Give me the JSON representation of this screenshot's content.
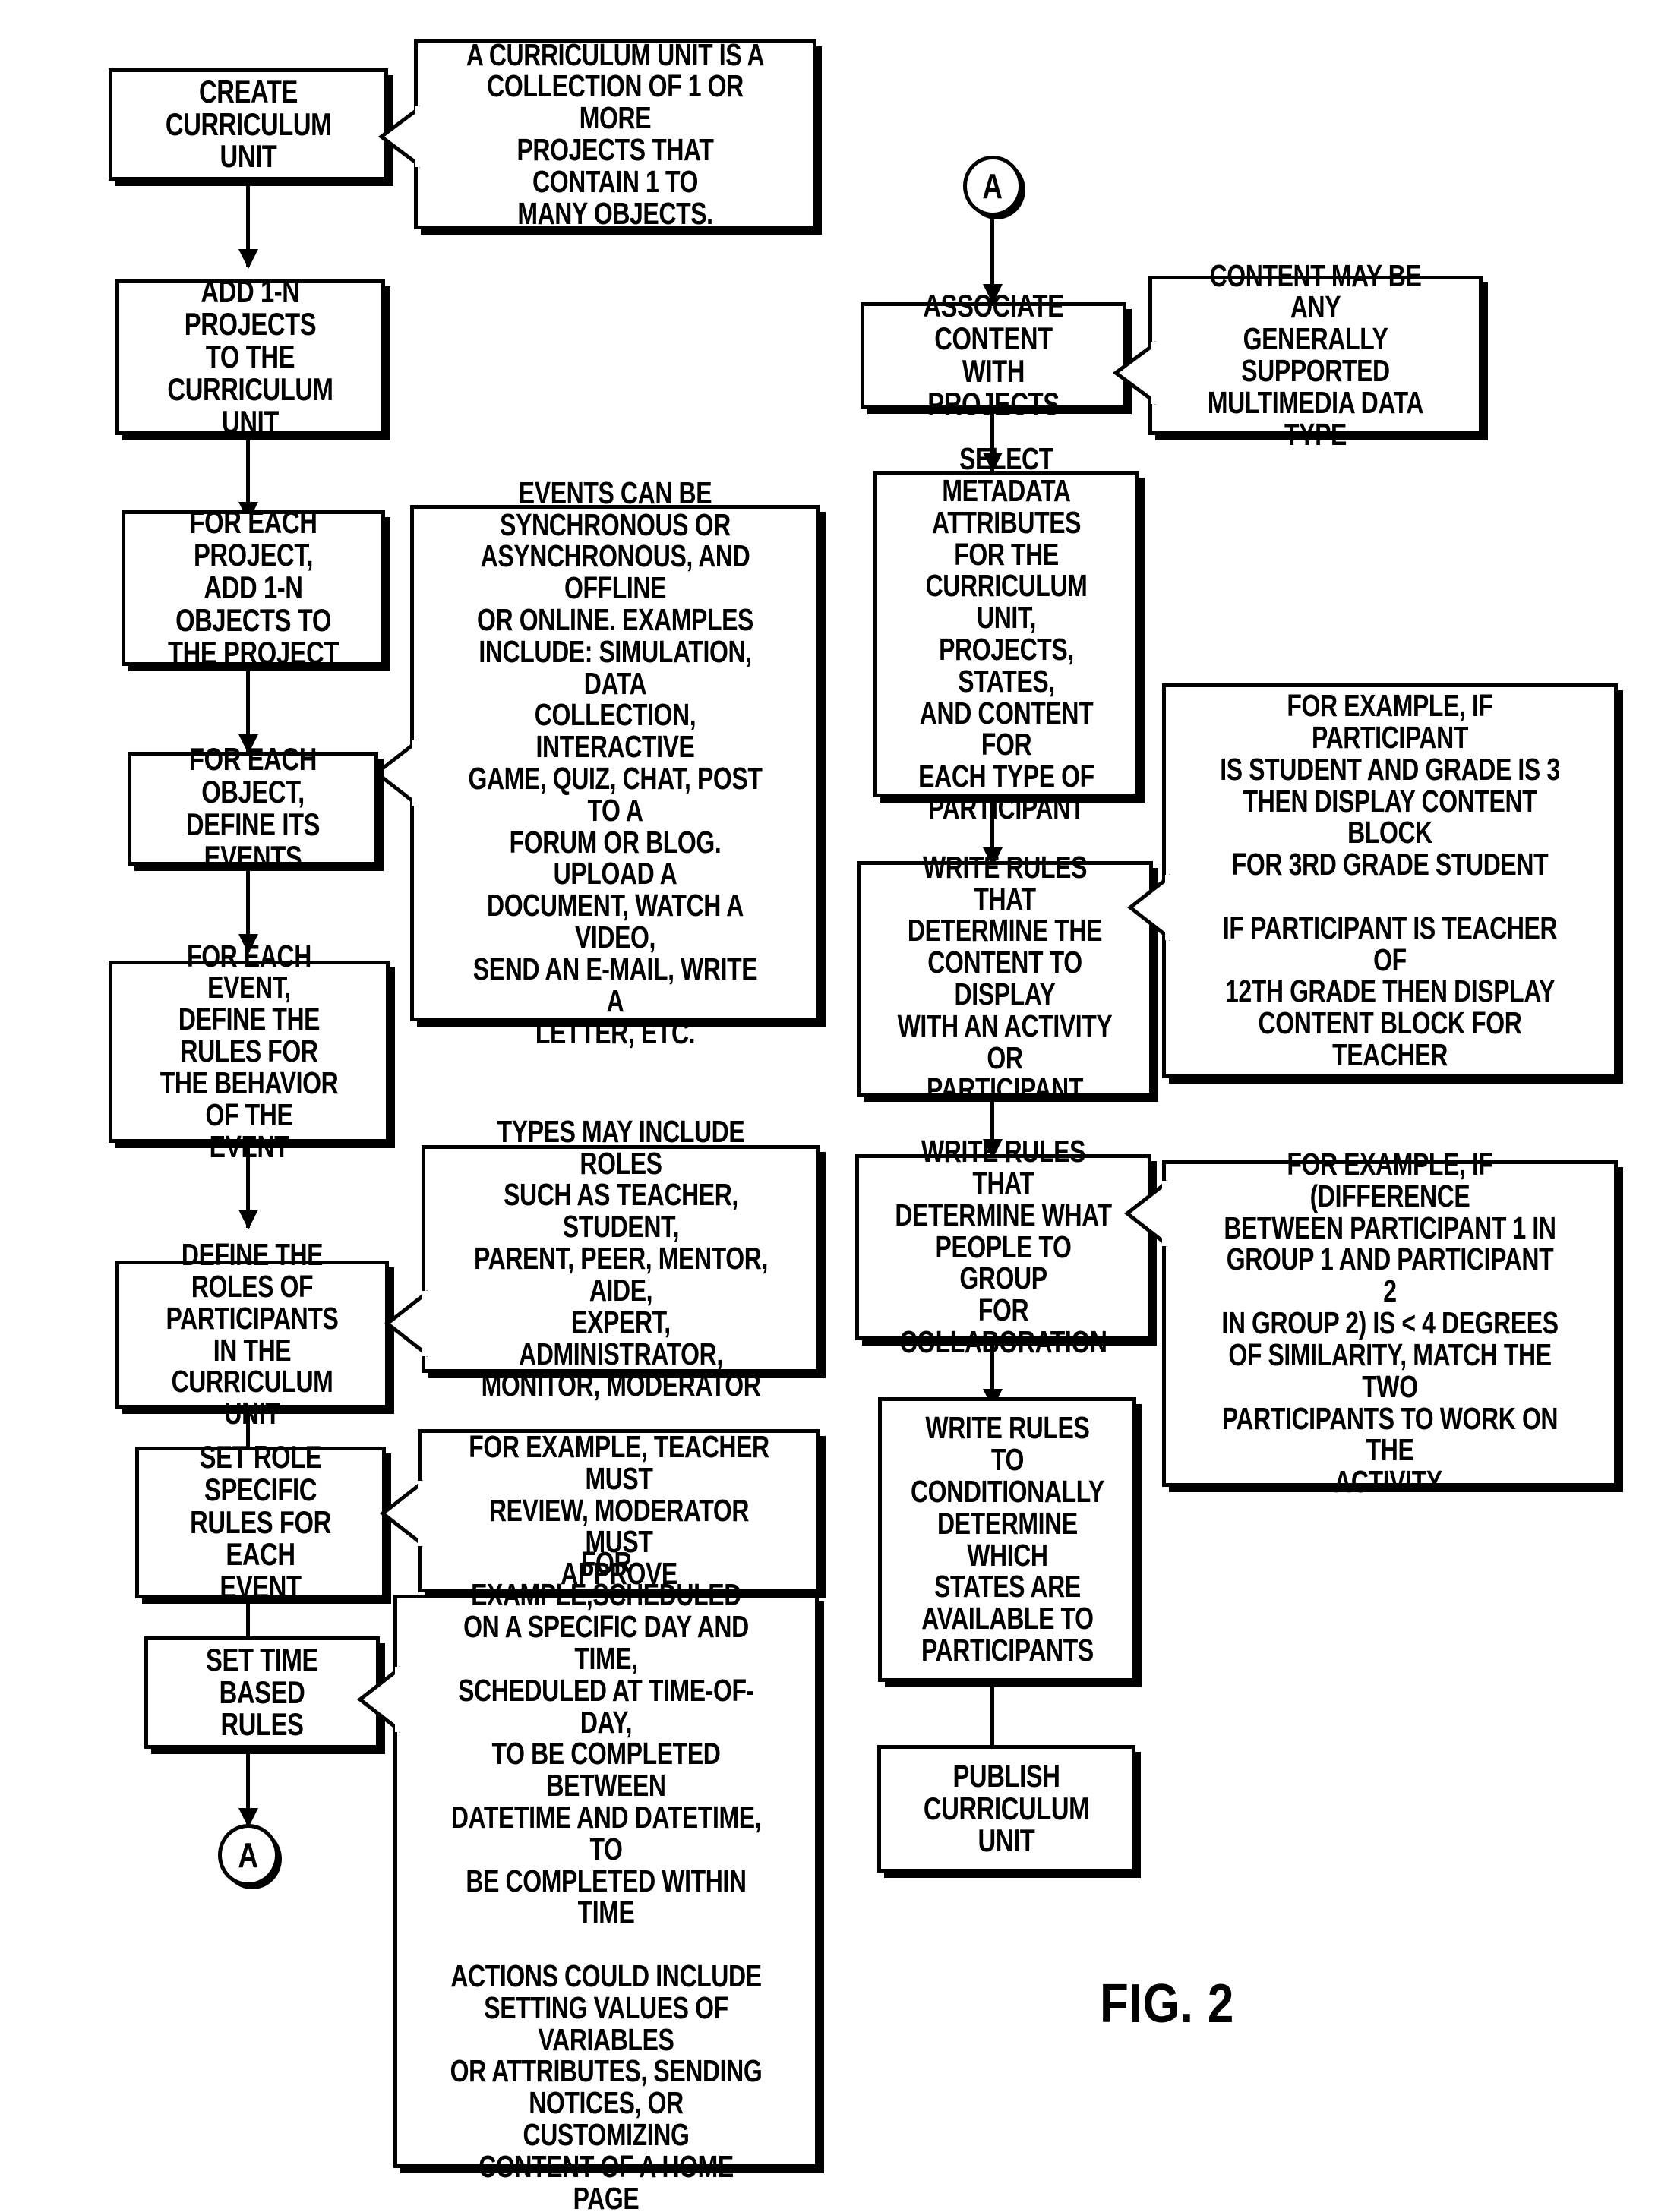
{
  "figure": {
    "caption": "FIG. 2"
  },
  "colors": {
    "ink": "#000000",
    "paper": "#ffffff"
  },
  "left_column": {
    "steps": [
      {
        "id": "create-curriculum-unit",
        "label": "CREATE CURRICULUM\nUNIT"
      },
      {
        "id": "add-projects",
        "label": "ADD 1-n PROJECTS\nTO THE CURRICULUM\nUNIT"
      },
      {
        "id": "add-objects",
        "label": "FOR EACH PROJECT,\nADD 1-n OBJECTS TO\nTHE PROJECT"
      },
      {
        "id": "define-events",
        "label": "FOR EACH OBJECT,\nDEFINE ITS EVENTS"
      },
      {
        "id": "define-event-rules",
        "label": "FOR EACH EVENT,\nDEFINE THE RULES FOR\nTHE BEHAVIOR OF THE\nEVENT"
      },
      {
        "id": "define-roles",
        "label": "DEFINE THE ROLES OF\nPARTICIPANTS IN THE\nCURRICULUM UNIT"
      },
      {
        "id": "set-role-rules",
        "label": "SET ROLE SPECIFIC\nRULES FOR EACH\nEVENT"
      },
      {
        "id": "set-time-rules",
        "label": "SET TIME BASED\nRULES"
      }
    ],
    "notes": [
      {
        "id": "note-curriculum-unit",
        "label": "A CURRICULUM UNIT IS A\nCOLLECTION OF 1 OR MORE\nPROJECTS THAT CONTAIN 1 TO\nMANY OBJECTS."
      },
      {
        "id": "note-events",
        "label": "EVENTS CAN BE\nSYNCHRONOUS OR\nASYNCHRONOUS, AND OFFLINE\nOR ONLINE. EXAMPLES\nINCLUDE: SIMULATION, DATA\nCOLLECTION, INTERACTIVE\nGAME, QUIZ, CHAT, POST TO A\nFORUM OR BLOG. UPLOAD A\nDOCUMENT, WATCH A VIDEO,\nSEND AN E-MAIL, WRITE A\nLETTER, ETC."
      },
      {
        "id": "note-role-types",
        "label": "TYPES MAY INCLUDE ROLES\nSUCH AS TEACHER, STUDENT,\nPARENT, PEER, MENTOR, AIDE,\nEXPERT, ADMINISTRATOR,\nMONITOR, MODERATOR"
      },
      {
        "id": "note-role-example",
        "label": "FOR EXAMPLE, TEACHER MUST\nREVIEW, MODERATOR MUST\nAPPROVE"
      },
      {
        "id": "note-time-example",
        "label": "FOR EXAMPLE,SCHEDULED\nON A SPECIFIC DAY AND TIME,\nSCHEDULED AT TIME-OF-DAY,\nTO BE COMPLETED BETWEEN\nDATETIME AND DATETIME, TO\nBE COMPLETED WITHIN TIME\n\nACTIONS COULD INCLUDE\nSETTING VALUES OF VARIABLES\nOR ATTRIBUTES, SENDING\nNOTICES, OR CUSTOMIZING\nCONTENT OF A HOME PAGE"
      }
    ],
    "connector_out": {
      "id": "connector-a-out",
      "label": "A"
    }
  },
  "right_column": {
    "connector_in": {
      "id": "connector-a-in",
      "label": "A"
    },
    "steps": [
      {
        "id": "associate-content",
        "label": "ASSOCIATE CONTENT\nWITH PROJECTS"
      },
      {
        "id": "select-metadata",
        "label": "SELECT METADATA\nATTRIBUTES FOR THE\nCURRICULUM UNIT,\nPROJECTS, STATES,\nAND CONTENT FOR\nEACH TYPE OF\nPARTICIPANT"
      },
      {
        "id": "write-content-rules",
        "label": "WRITE RULES THAT\nDETERMINE THE\nCONTENT TO DISPLAY\nWITH AN ACTIVITY OR\nPARTICIPANT"
      },
      {
        "id": "write-group-rules",
        "label": "WRITE RULES THAT\nDETERMINE WHAT\nPEOPLE TO GROUP\nFOR COLLABORATION"
      },
      {
        "id": "write-state-rules",
        "label": "WRITE RULES TO\nCONDITIONALLY\nDETERMINE WHICH\nSTATES ARE\nAVAILABLE TO\nPARTICIPANTS"
      },
      {
        "id": "publish-curriculum-unit",
        "label": "PUBLISH\nCURRICULUM UNIT"
      }
    ],
    "notes": [
      {
        "id": "note-content-type",
        "label": "CONTENT MAY BE ANY\nGENERALLY SUPPORTED\nMULTIMEDIA DATA TYPE"
      },
      {
        "id": "note-participant-example",
        "label": "FOR EXAMPLE, IF PARTICIPANT\nIS STUDENT AND GRADE IS 3\nTHEN DISPLAY CONTENT BLOCK\nFOR 3RD GRADE STUDENT\n\nIF PARTICIPANT IS TEACHER OF\n12TH GRADE THEN DISPLAY\nCONTENT BLOCK FOR TEACHER"
      },
      {
        "id": "note-group-example",
        "label": "FOR EXAMPLE, IF (DIFFERENCE\nBETWEEN PARTICIPANT 1 IN\nGROUP 1 AND PARTICIPANT 2\nIN GROUP 2) IS < 4 DEGREES\nOF SIMILARITY, MATCH THE TWO\nPARTICIPANTS TO WORK ON THE\nACTIVITY."
      }
    ]
  }
}
